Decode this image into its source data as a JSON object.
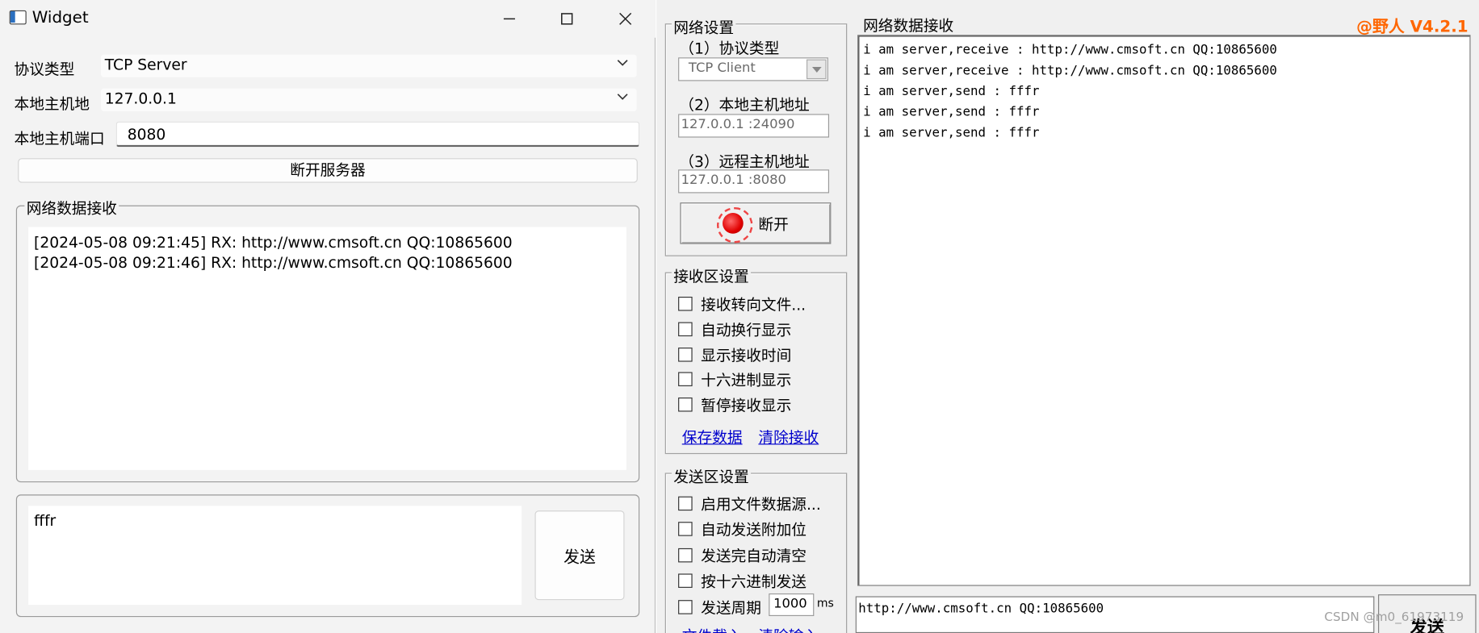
{
  "widget_window": {
    "title": "Widget",
    "controls": {
      "minimize": "—",
      "maximize": "☐",
      "close": "✕"
    },
    "protocol_label": "协议类型",
    "protocol_value": "TCP Server",
    "host_label": "本地主机地",
    "host_value": "127.0.0.1",
    "port_label": "本地主机端口",
    "port_value": "8080",
    "disconnect_button": "断开服务器",
    "recv_group_title": "网络数据接收",
    "recv_lines": [
      "[2024-05-08 09:21:45] RX: http://www.cmsoft.cn QQ:10865600",
      "[2024-05-08 09:21:46] RX: http://www.cmsoft.cn QQ:10865600"
    ],
    "send_text": "fffr",
    "send_button": "发送"
  },
  "netassist_window": {
    "version": "@野人 V4.2.1",
    "net_settings_title": "网络设置",
    "protocol_label": "（1）协议类型",
    "protocol_value": "TCP Client",
    "local_label": "（2）本地主机地址",
    "local_value": "127.0.0.1 :24090",
    "remote_label": "（3）远程主机地址",
    "remote_value": "127.0.0.1 :8080",
    "disconnect_button": "断开",
    "recv_settings_title": "接收区设置",
    "recv_options": [
      "接收转向文件...",
      "自动换行显示",
      "显示接收时间",
      "十六进制显示",
      "暂停接收显示"
    ],
    "save_link": "保存数据",
    "clear_link": "清除接收",
    "send_settings_title": "发送区设置",
    "send_options": [
      "启用文件数据源...",
      "自动发送附加位",
      "发送完自动清空",
      "按十六进制发送",
      "发送周期"
    ],
    "period_value": "1000",
    "period_unit": "ms",
    "bottom_links": [
      "文件载入",
      "清除输入"
    ],
    "recv_area_title": "网络数据接收",
    "recv_lines": [
      "i am server,receive : http://www.cmsoft.cn QQ:10865600",
      "i am server,receive : http://www.cmsoft.cn QQ:10865600",
      "i am server,send : fffr",
      "i am server,send : fffr",
      "i am server,send : fffr"
    ],
    "send_text": "http://www.cmsoft.cn QQ:10865600",
    "send_button": "发送",
    "watermark": "CSDN @m0_61973119"
  },
  "colors": {
    "accent_version": "#ff6600",
    "link": "#0000cc",
    "led": "#e00000"
  }
}
